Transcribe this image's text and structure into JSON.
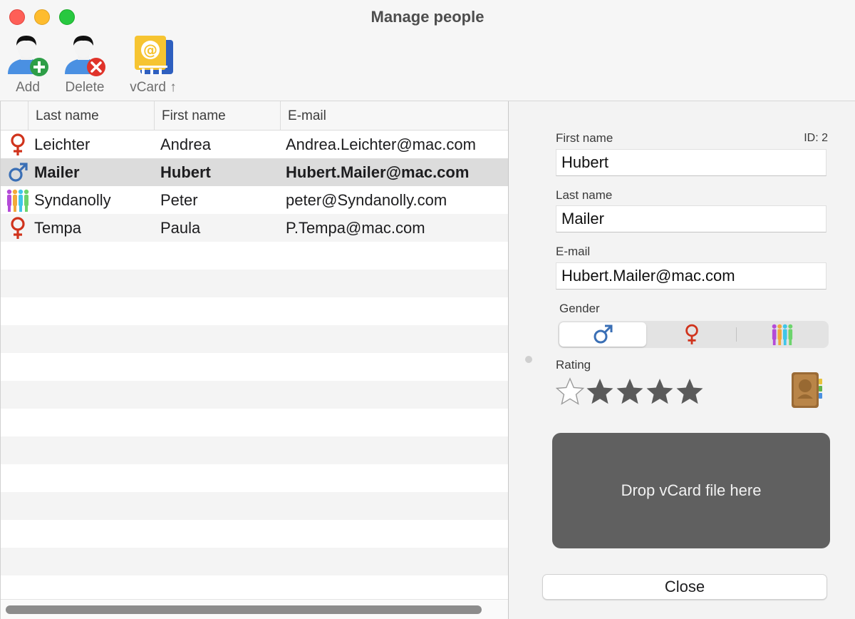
{
  "window": {
    "title": "Manage people"
  },
  "toolbar": {
    "add_label": "Add",
    "delete_label": "Delete",
    "vcard_label": "vCard ↑"
  },
  "table": {
    "columns": [
      "Last name",
      "First name",
      "E-mail"
    ],
    "rows": [
      {
        "gender": "female",
        "last": "Leichter",
        "first": "Andrea",
        "email": "Andrea.Leichter@mac.com",
        "selected": false
      },
      {
        "gender": "male",
        "last": "Mailer",
        "first": "Hubert",
        "email": "Hubert.Mailer@mac.com",
        "selected": true
      },
      {
        "gender": "diverse",
        "last": "Syndanolly",
        "first": "Peter",
        "email": "peter@Syndanolly.com",
        "selected": false
      },
      {
        "gender": "female",
        "last": "Tempa",
        "first": "Paula",
        "email": "P.Tempa@mac.com",
        "selected": false
      }
    ]
  },
  "detail": {
    "first_name_label": "First name",
    "id_label": "ID: 2",
    "first_name_value": "Hubert",
    "last_name_label": "Last name",
    "last_name_value": "Mailer",
    "email_label": "E-mail",
    "email_value": "Hubert.Mailer@mac.com",
    "gender_label": "Gender",
    "gender_options": [
      "male",
      "female",
      "diverse"
    ],
    "gender_selected": "male",
    "rating_label": "Rating",
    "rating": 4,
    "rating_max": 5,
    "dropzone_text": "Drop vCard file here",
    "close_label": "Close"
  },
  "colors": {
    "female": "#d0331c",
    "male": "#3a6fb5",
    "selected_row": "#dcdcdc",
    "dropzone": "#606060",
    "star": "#5a5a5a"
  }
}
